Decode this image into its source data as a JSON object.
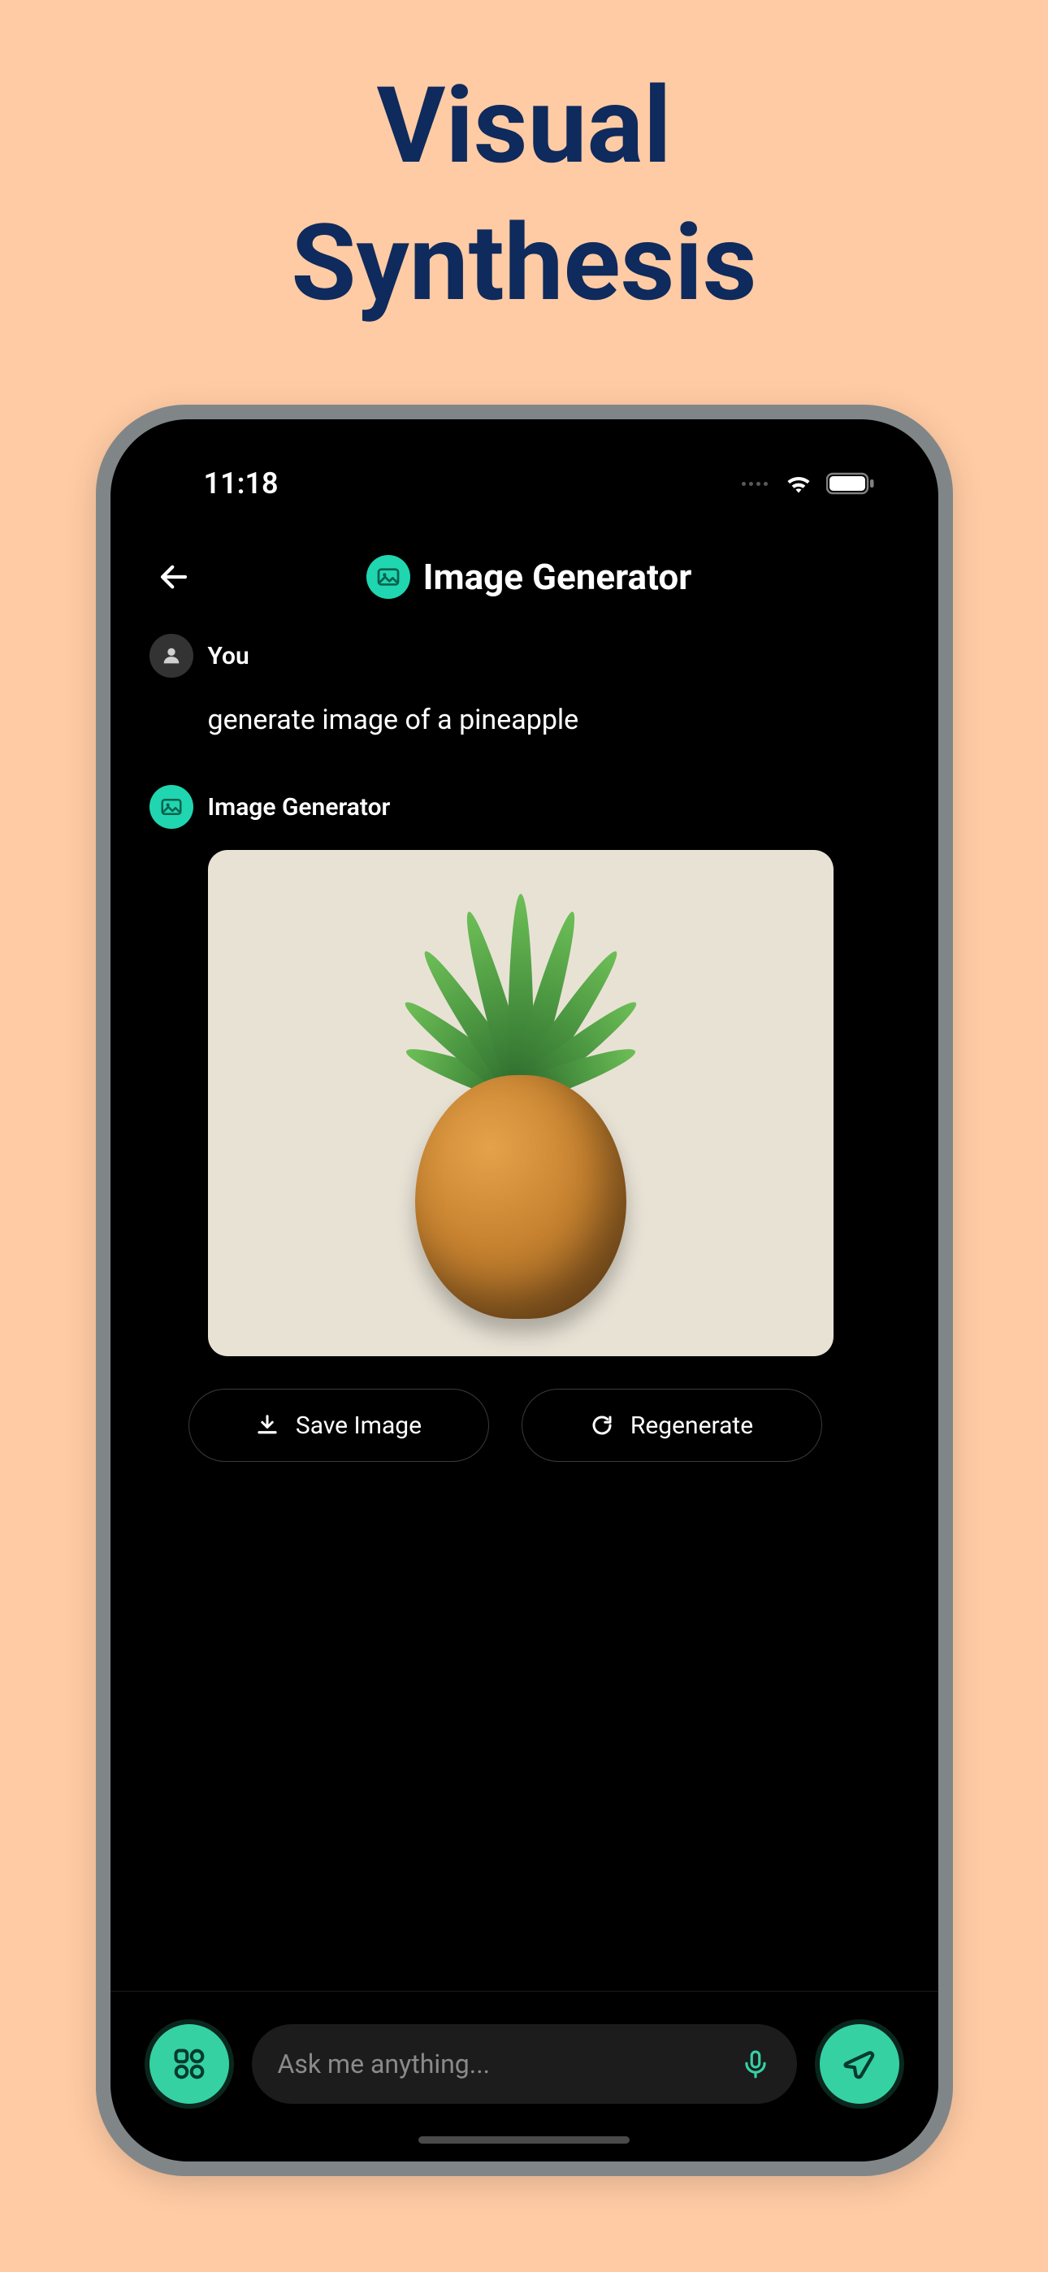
{
  "hero": {
    "line1": "Visual",
    "line2": "Synthesis"
  },
  "status": {
    "time": "11:18"
  },
  "header": {
    "title": "Image Generator"
  },
  "chat": {
    "user_label": "You",
    "user_message": "generate image of a pineapple",
    "bot_label": "Image Generator",
    "image_description": "pineapple"
  },
  "actions": {
    "save_label": "Save Image",
    "regenerate_label": "Regenerate"
  },
  "input": {
    "placeholder": "Ask me anything..."
  }
}
